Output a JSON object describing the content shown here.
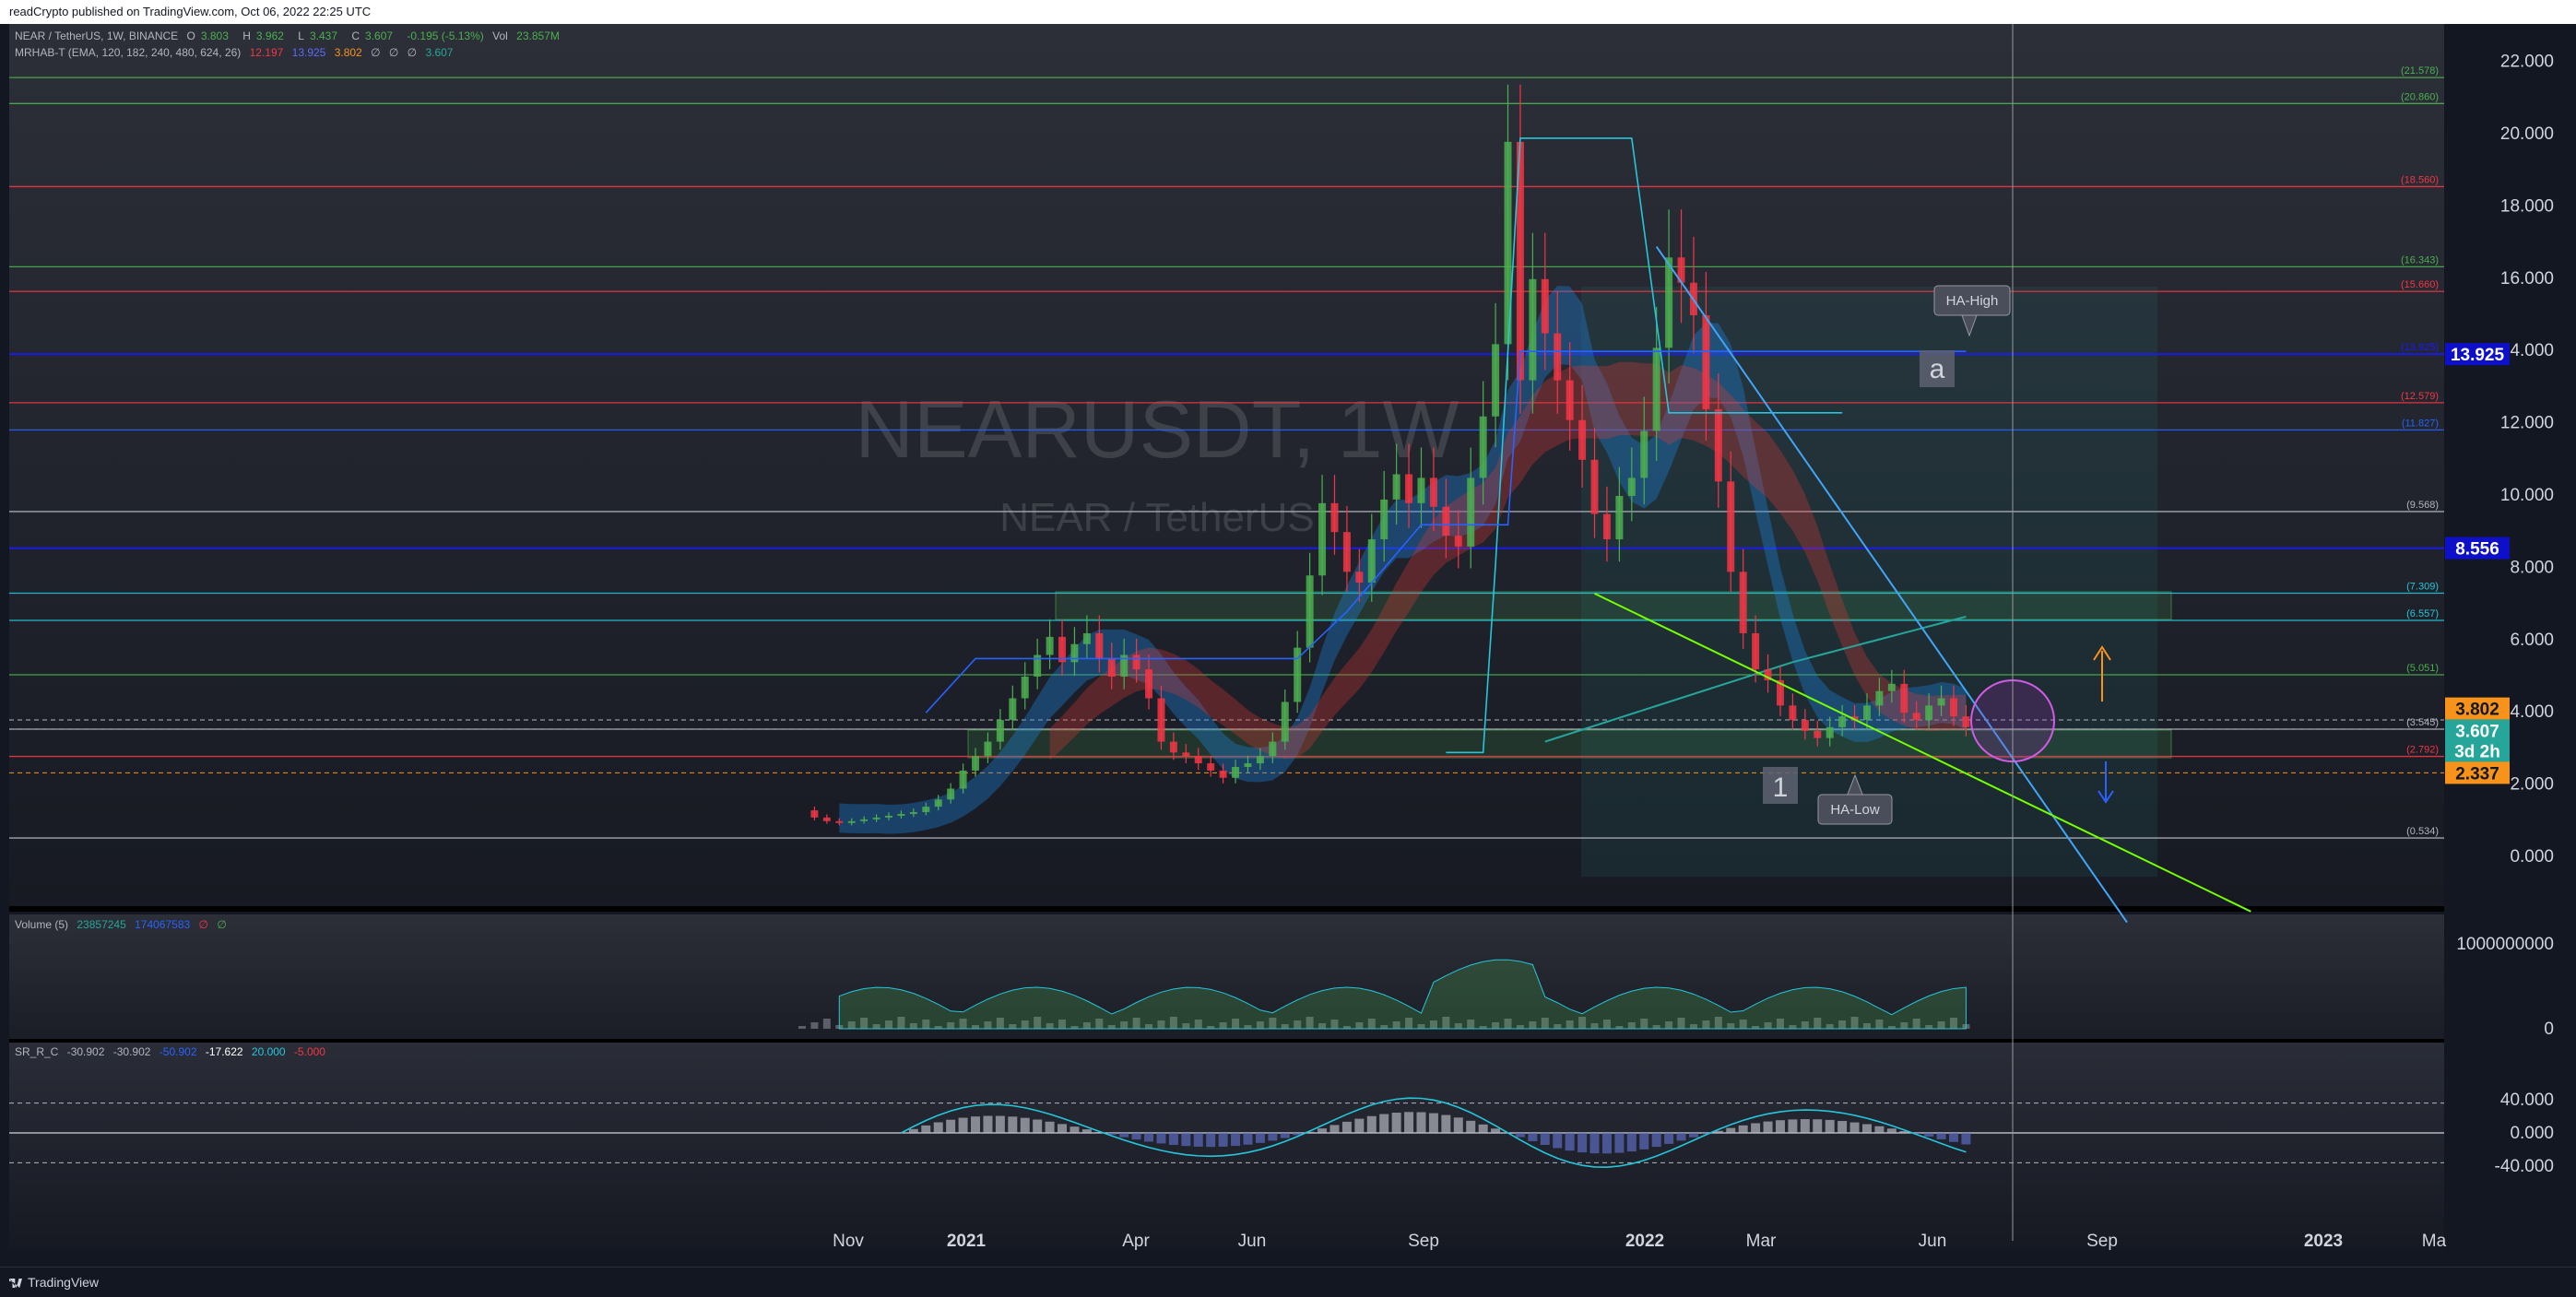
{
  "header": {
    "published_text": "readCrypto published on TradingView.com, Oct 06, 2022 22:25 UTC"
  },
  "footer": {
    "brand": "TradingView"
  },
  "symbol": {
    "watermark_ticker": "NEARUSDT, 1W",
    "watermark_name": "NEAR / TetherUS",
    "legend_title": "NEAR / TetherUS, 1W, BINANCE",
    "ohlc": {
      "o_label": "O",
      "o": "3.803",
      "h_label": "H",
      "h": "3.962",
      "l_label": "L",
      "l": "3.437",
      "c_label": "C",
      "c": "3.607",
      "change": "-0.195 (-5.13%)",
      "vol_label": "Vol",
      "vol": "23.857M"
    },
    "indicator_label": "MRHAB-T (EMA, 120, 182, 240, 480, 624, 26)",
    "indicator_values": [
      "12.197",
      "13.925",
      "3.802",
      "∅",
      "∅",
      "∅",
      "3.607"
    ]
  },
  "price_axis": {
    "ticks": [
      "22.000",
      "20.000",
      "18.000",
      "16.000",
      "14.000",
      "12.000",
      "10.000",
      "8.000",
      "6.000",
      "4.000",
      "2.000",
      "0.000"
    ]
  },
  "price_badges": [
    {
      "label": "13.925",
      "color": "#0d10c8",
      "text_color": "#ffffff"
    },
    {
      "label": "8.556",
      "color": "#0d10c8",
      "text_color": "#ffffff"
    },
    {
      "label": "3.802",
      "color": "#f7931a",
      "text_color": "#131722"
    },
    {
      "label": "3.607",
      "color": "#26a69a",
      "text_color": "#ffffff"
    },
    {
      "label": "3d 2h",
      "color": "#26a69a",
      "text_color": "#ffffff"
    },
    {
      "label": "2.337",
      "color": "#f7931a",
      "text_color": "#131722"
    }
  ],
  "level_labels": [
    "(21.578)",
    "(20.860)",
    "(18.560)",
    "(16.343)",
    "(15.660)",
    "(13.925)",
    "(12.579)",
    "(11.827)",
    "(9.568)",
    "(7.309)",
    "(6.557)",
    "(5.051)",
    "(3.545)",
    "(2.792)",
    "(0.534)"
  ],
  "level_colors": {
    "green": "#4caf50",
    "red": "#f23645",
    "blue": "#2962ff",
    "navy": "#1a1aff",
    "white": "#b2b5be",
    "cyan": "#26c6da"
  },
  "annotations": {
    "ha_high": "HA-High",
    "ha_low": "HA-Low",
    "label_a": "a",
    "label_1": "1"
  },
  "volume_pane": {
    "legend_name": "Volume (5)",
    "legend_v1": "23857245",
    "legend_v2": "174067583",
    "axis_ticks": [
      "1000000000",
      "0"
    ]
  },
  "oscillator_pane": {
    "legend_name": "SR_R_C",
    "legend_values": [
      "-30.902",
      "-30.902",
      "-50.902",
      "-17.622",
      "20.000",
      "-5.000"
    ],
    "axis_ticks": [
      "40.000",
      "0.000",
      "-40.000"
    ]
  },
  "time_axis": {
    "ticks": [
      "Nov",
      "2021",
      "Apr",
      "Jun",
      "Sep",
      "2022",
      "Mar",
      "Jun",
      "Sep",
      "2023",
      "Ma"
    ]
  },
  "colors": {
    "bg": "#131722",
    "up": "#4caf50",
    "down": "#f23645",
    "ema_green": "#26a69a",
    "ribbon_red": "#b71c1c",
    "ribbon_blue": "#1565c0"
  }
}
